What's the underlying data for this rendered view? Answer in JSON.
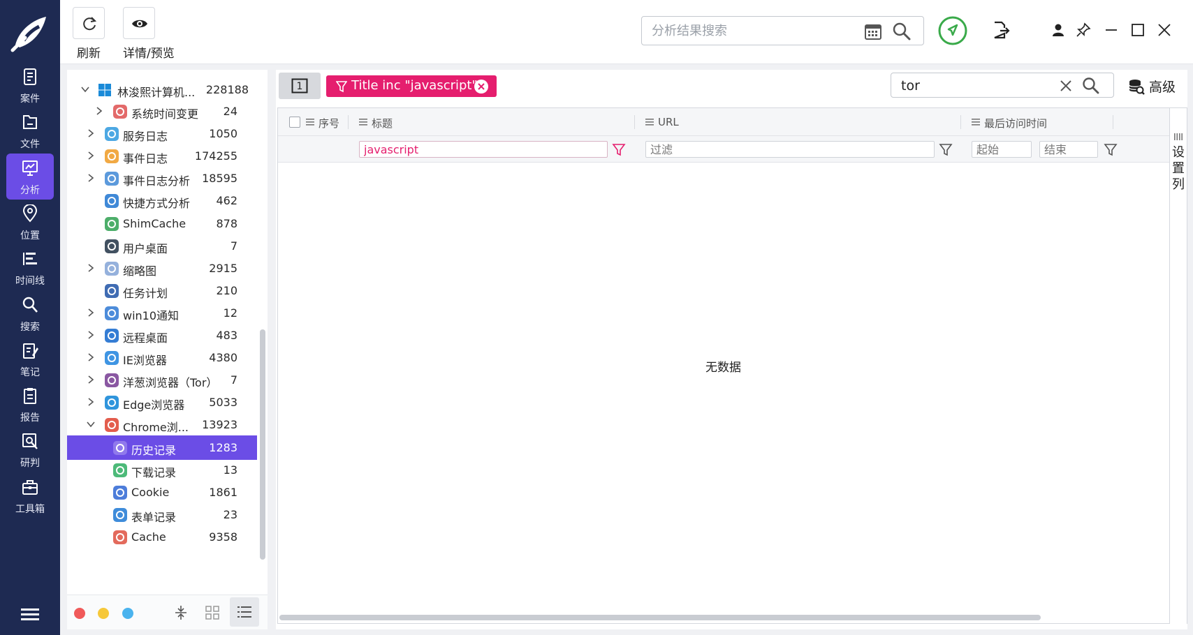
{
  "rail": {
    "items": [
      {
        "label": "案件",
        "icon": "case-icon",
        "active": false
      },
      {
        "label": "文件",
        "icon": "file-icon",
        "active": false
      },
      {
        "label": "分析",
        "icon": "analysis-icon",
        "active": true
      },
      {
        "label": "位置",
        "icon": "location-icon",
        "active": false
      },
      {
        "label": "时间线",
        "icon": "timeline-icon",
        "active": false
      },
      {
        "label": "搜索",
        "icon": "search-icon",
        "active": false
      },
      {
        "label": "笔记",
        "icon": "notes-icon",
        "active": false
      },
      {
        "label": "报告",
        "icon": "report-icon",
        "active": false
      },
      {
        "label": "研判",
        "icon": "judgement-icon",
        "active": false
      },
      {
        "label": "工具箱",
        "icon": "toolbox-icon",
        "active": false
      }
    ]
  },
  "toolbar": {
    "refresh_label": "刷新",
    "preview_label": "详情/预览",
    "search_placeholder": "分析结果搜索"
  },
  "tree": {
    "root": {
      "label": "林浚熙计算机...",
      "count": "228188"
    },
    "items": [
      {
        "label": "系统时间变更",
        "count": "24",
        "level": 2,
        "chevron": "right",
        "icon": "clock-icon",
        "color": "#e05a5a"
      },
      {
        "label": "服务日志",
        "count": "1050",
        "level": 1,
        "chevron": "right",
        "icon": "service-log-icon",
        "color": "#3a9fe0"
      },
      {
        "label": "事件日志",
        "count": "174255",
        "level": 1,
        "chevron": "right",
        "icon": "event-log-icon",
        "color": "#f0a030"
      },
      {
        "label": "事件日志分析",
        "count": "18595",
        "level": 1,
        "chevron": "right",
        "icon": "event-analysis-icon",
        "color": "#4a8fd8"
      },
      {
        "label": "快捷方式分析",
        "count": "462",
        "level": 1,
        "chevron": "none",
        "icon": "shortcut-icon",
        "color": "#2b7cd3"
      },
      {
        "label": "ShimCache",
        "count": "878",
        "level": 1,
        "chevron": "none",
        "icon": "shimcache-icon",
        "color": "#3aa55a"
      },
      {
        "label": "用户桌面",
        "count": "7",
        "level": 1,
        "chevron": "none",
        "icon": "desktop-icon",
        "color": "#2d3e50"
      },
      {
        "label": "缩略图",
        "count": "2915",
        "level": 1,
        "chevron": "right",
        "icon": "thumbnail-icon",
        "color": "#8aa8d8"
      },
      {
        "label": "任务计划",
        "count": "210",
        "level": 1,
        "chevron": "none",
        "icon": "task-icon",
        "color": "#2b5cab"
      },
      {
        "label": "win10通知",
        "count": "12",
        "level": 1,
        "chevron": "right",
        "icon": "notification-icon",
        "color": "#3a7fd6"
      },
      {
        "label": "远程桌面",
        "count": "483",
        "level": 1,
        "chevron": "right",
        "icon": "remote-desktop-icon",
        "color": "#1f6fcf"
      },
      {
        "label": "IE浏览器",
        "count": "4380",
        "level": 1,
        "chevron": "right",
        "icon": "ie-icon",
        "color": "#2a8ae0"
      },
      {
        "label": "洋葱浏览器（Tor）",
        "count": "7",
        "level": 1,
        "chevron": "right",
        "icon": "tor-icon",
        "color": "#7d4698"
      },
      {
        "label": "Edge浏览器",
        "count": "5033",
        "level": 1,
        "chevron": "right",
        "icon": "edge-icon",
        "color": "#1a8ad8"
      },
      {
        "label": "Chrome浏...",
        "count": "13923",
        "level": 1,
        "chevron": "down",
        "icon": "chrome-icon",
        "color": "#e04b3a"
      },
      {
        "label": "历史记录",
        "count": "1283",
        "level": 2,
        "chevron": "none",
        "icon": "history-icon",
        "color": "#6b4de6",
        "selected": true
      },
      {
        "label": "下载记录",
        "count": "13",
        "level": 2,
        "chevron": "none",
        "icon": "download-icon",
        "color": "#3ab26a"
      },
      {
        "label": "Cookie",
        "count": "1861",
        "level": 2,
        "chevron": "none",
        "icon": "cookie-icon",
        "color": "#3a6fd6"
      },
      {
        "label": "表单记录",
        "count": "23",
        "level": 2,
        "chevron": "none",
        "icon": "form-icon",
        "color": "#2a7fd6"
      },
      {
        "label": "Cache",
        "count": "9358",
        "level": 2,
        "chevron": "none",
        "icon": "cache-icon",
        "color": "#e05a4a"
      }
    ]
  },
  "filter_bar": {
    "tab_toggle_label": "1",
    "chip_text": "Title inc \"javascript\"",
    "search_value": "tor",
    "advanced_label": "高级"
  },
  "table": {
    "columns": [
      {
        "label": "序号"
      },
      {
        "label": "标题"
      },
      {
        "label": "URL"
      },
      {
        "label": "最后访问时间"
      }
    ],
    "title_filter_value": "javascript",
    "url_filter_placeholder": "过滤",
    "time_start_placeholder": "起始",
    "time_end_placeholder": "结束",
    "empty_text": "无数据",
    "column_settings_label": "设置列"
  },
  "colors": {
    "rail": "#1e2a52",
    "accent": "#6b4de6",
    "filter_chip": "#e51e6e",
    "status_green": "#3aaa4a"
  }
}
